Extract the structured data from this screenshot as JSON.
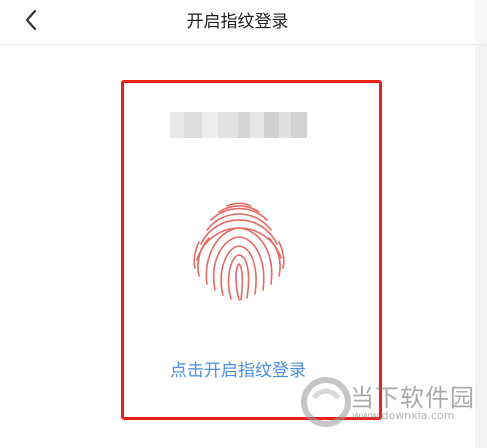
{
  "header": {
    "title": "开启指纹登录",
    "back_icon": "chevron-left-icon"
  },
  "main": {
    "account_name_masked": true,
    "fingerprint_icon": "fingerprint-icon",
    "enable_link": "点击开启指纹登录"
  },
  "watermark": {
    "name": "当下软件园",
    "url": "www.downxia.com"
  },
  "colors": {
    "highlight": "#e8221b",
    "fingerprint": "#e46a63",
    "link": "#4a90e2"
  }
}
